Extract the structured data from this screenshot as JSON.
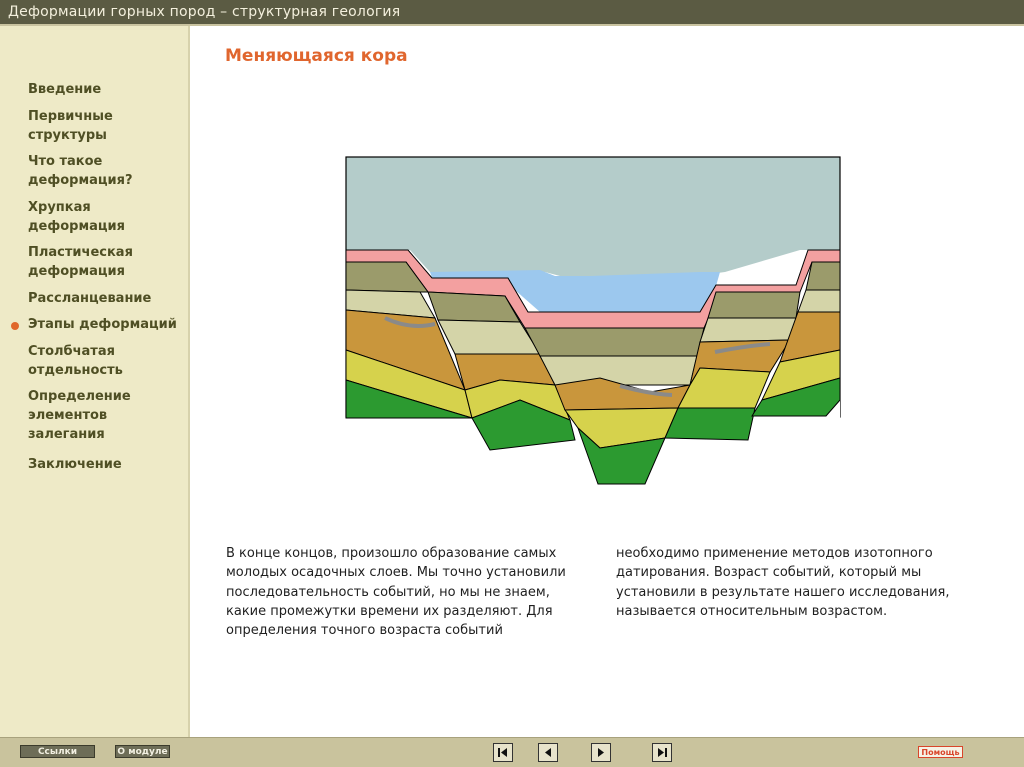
{
  "window": {
    "title": "Деформации горных пород – структурная геология"
  },
  "sidebar": {
    "items": [
      {
        "label": "Введение",
        "active": false
      },
      {
        "label": "Первичные структуры",
        "active": false
      },
      {
        "label": "Что такое деформация?",
        "active": false
      },
      {
        "label": "Хрупкая деформация",
        "active": false
      },
      {
        "label": "Пластическая деформация",
        "active": false
      },
      {
        "label": "Рассланцевание",
        "active": false
      },
      {
        "label": "Этапы деформаций",
        "active": true
      },
      {
        "label": "Столбчатая отдельность",
        "active": false
      },
      {
        "label": "Определение элементов залегания",
        "active": false
      },
      {
        "label": "Заключение",
        "active": false
      }
    ]
  },
  "main": {
    "title": "Меняющаяся кора",
    "text_left": "В конце концов, произошло образование самых молодых осадочных слоев. Мы точно установили последовательность событий, но мы не знаем, какие промежутки времени их разделяют. Для определения точного возраста событий",
    "text_right": "необходимо применение методов изотопного датирования. Возраст событий, который мы установили в результате нашего исследования, называется относительным возрастом."
  },
  "bottombar": {
    "links_label": "Ссылки",
    "about_label": "О модуле",
    "help_label": "Помощь"
  },
  "colors": {
    "accent": "#e0662e",
    "sidebar_bg": "#eeeac7",
    "titlebar_bg": "#5b5b43",
    "bottombar_bg": "#c9c39d"
  }
}
